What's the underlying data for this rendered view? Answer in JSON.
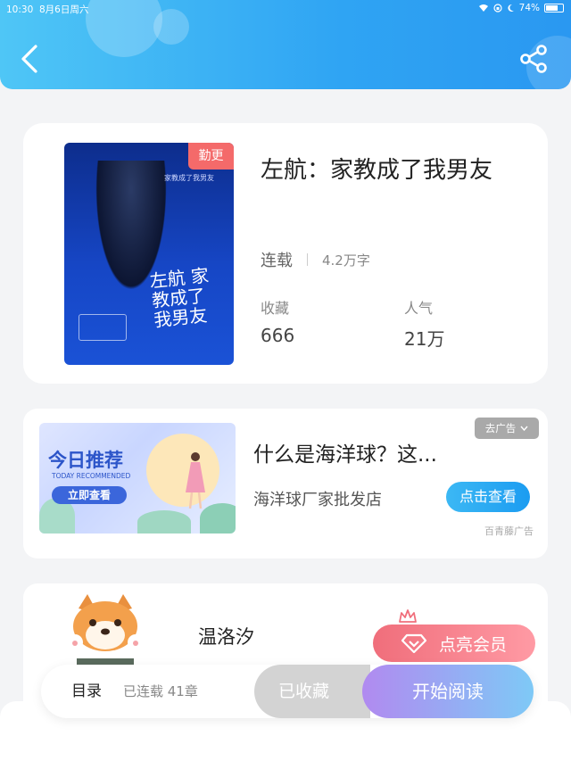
{
  "status_bar": {
    "time": "10:30",
    "date": "8月6日周六",
    "battery": "74%",
    "battery_level": 0.74
  },
  "header": {
    "back_icon": "chevron-left-icon",
    "share_icon": "share-icon",
    "gradient": [
      "#4fc6f6",
      "#2a98f1"
    ]
  },
  "book": {
    "title": "左航：家教成了我男友",
    "cover_tag": "勤更",
    "cover_subtitle": "家教成了我男友",
    "cover_calligraphy": "左航 家教成了 我男友",
    "status": "连载",
    "word_count": "4.2万字",
    "stats": [
      {
        "label": "收藏",
        "value": "666"
      },
      {
        "label": "人气",
        "value": "21万"
      }
    ]
  },
  "ad": {
    "banner_title": "今日推荐",
    "banner_subtitle": "TODAY RECOMMENDED",
    "banner_button": "立即查看",
    "title": "什么是海洋球？这...",
    "store": "海洋球厂家批发店",
    "close_label": "去广告",
    "cta": "点击查看",
    "source": "百青藤广告"
  },
  "author": {
    "name": "温洛汐",
    "vip_button": "点亮会员",
    "vip_icon": "diamond-icon",
    "crown_icon": "crown-icon"
  },
  "toolbar": {
    "toc": "目录",
    "chapters": "已连载 41章",
    "collected": "已收藏",
    "start_reading": "开始阅读"
  },
  "colors": {
    "accent": "#2fa4f3",
    "tag": "#f46a6a",
    "vip": "#f06e7b"
  }
}
